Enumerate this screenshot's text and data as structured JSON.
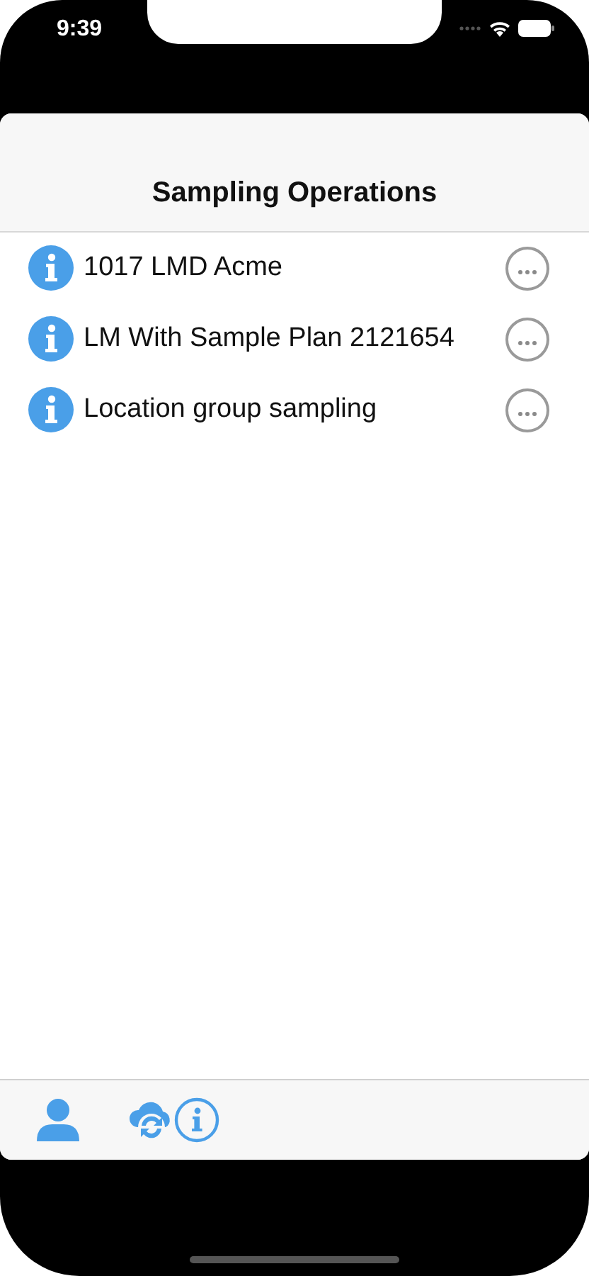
{
  "status_bar": {
    "time": "9:39"
  },
  "nav_bar": {
    "title": "Sampling Operations"
  },
  "operations": [
    {
      "name": "1017 LMD Acme"
    },
    {
      "name": "LM With Sample Plan 2121654"
    },
    {
      "name": "Location group sampling"
    }
  ]
}
